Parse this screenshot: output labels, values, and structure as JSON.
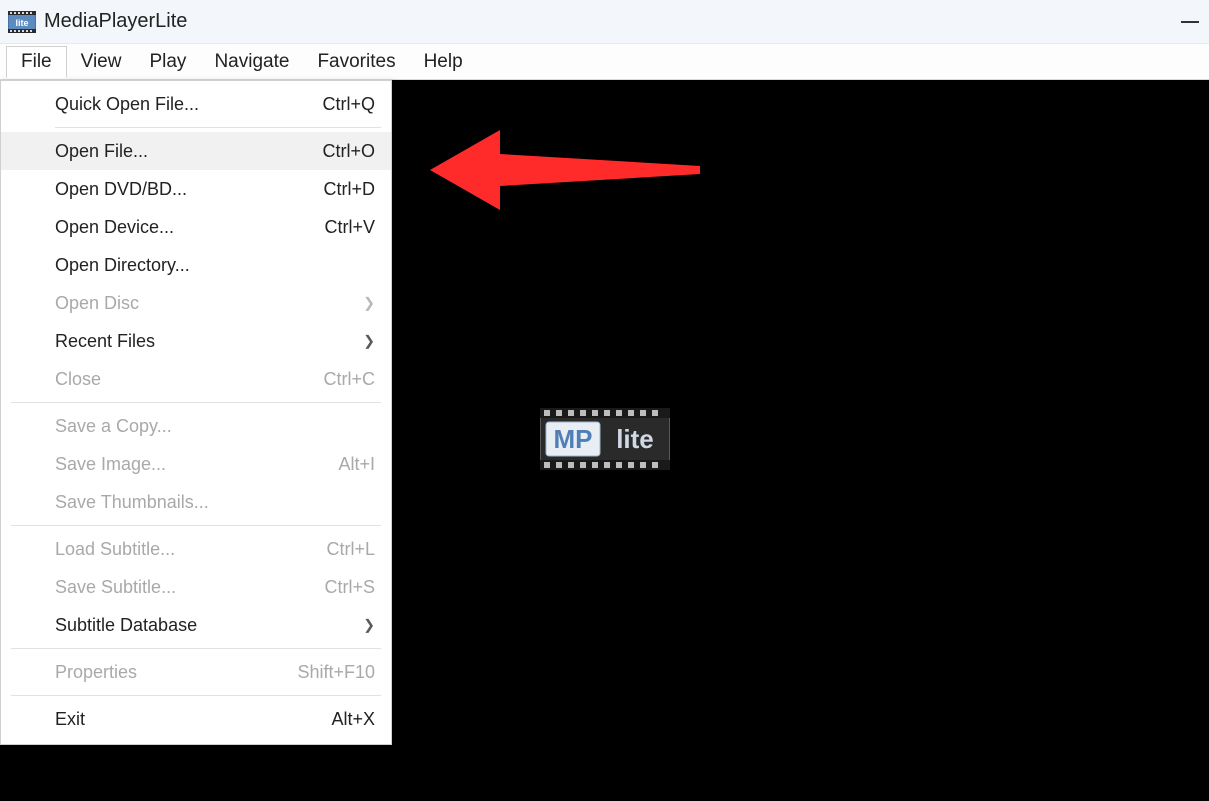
{
  "titlebar": {
    "title": "MediaPlayerLite"
  },
  "menubar": {
    "items": [
      "File",
      "View",
      "Play",
      "Navigate",
      "Favorites",
      "Help"
    ],
    "active_index": 0
  },
  "file_menu": {
    "groups": [
      [
        {
          "label": "Quick Open File...",
          "shortcut": "Ctrl+Q",
          "submenu": false,
          "disabled": false,
          "hover": false
        }
      ],
      [
        {
          "label": "Open File...",
          "shortcut": "Ctrl+O",
          "submenu": false,
          "disabled": false,
          "hover": true
        },
        {
          "label": "Open DVD/BD...",
          "shortcut": "Ctrl+D",
          "submenu": false,
          "disabled": false,
          "hover": false
        },
        {
          "label": "Open Device...",
          "shortcut": "Ctrl+V",
          "submenu": false,
          "disabled": false,
          "hover": false
        },
        {
          "label": "Open Directory...",
          "shortcut": "",
          "submenu": false,
          "disabled": false,
          "hover": false
        },
        {
          "label": "Open Disc",
          "shortcut": "",
          "submenu": true,
          "disabled": true,
          "hover": false
        },
        {
          "label": "Recent Files",
          "shortcut": "",
          "submenu": true,
          "disabled": false,
          "hover": false
        },
        {
          "label": "Close",
          "shortcut": "Ctrl+C",
          "submenu": false,
          "disabled": true,
          "hover": false
        }
      ],
      [
        {
          "label": "Save a Copy...",
          "shortcut": "",
          "submenu": false,
          "disabled": true,
          "hover": false
        },
        {
          "label": "Save Image...",
          "shortcut": "Alt+I",
          "submenu": false,
          "disabled": true,
          "hover": false
        },
        {
          "label": "Save Thumbnails...",
          "shortcut": "",
          "submenu": false,
          "disabled": true,
          "hover": false
        }
      ],
      [
        {
          "label": "Load Subtitle...",
          "shortcut": "Ctrl+L",
          "submenu": false,
          "disabled": true,
          "hover": false
        },
        {
          "label": "Save Subtitle...",
          "shortcut": "Ctrl+S",
          "submenu": false,
          "disabled": true,
          "hover": false
        },
        {
          "label": "Subtitle Database",
          "shortcut": "",
          "submenu": true,
          "disabled": false,
          "hover": false
        }
      ],
      [
        {
          "label": "Properties",
          "shortcut": "Shift+F10",
          "submenu": false,
          "disabled": true,
          "hover": false
        }
      ],
      [
        {
          "label": "Exit",
          "shortcut": "Alt+X",
          "submenu": false,
          "disabled": false,
          "hover": false
        }
      ]
    ]
  },
  "logo": {
    "mp": "MP",
    "lite": "lite"
  },
  "annotation": {
    "type": "left-arrow",
    "color": "#ff2b2b"
  }
}
